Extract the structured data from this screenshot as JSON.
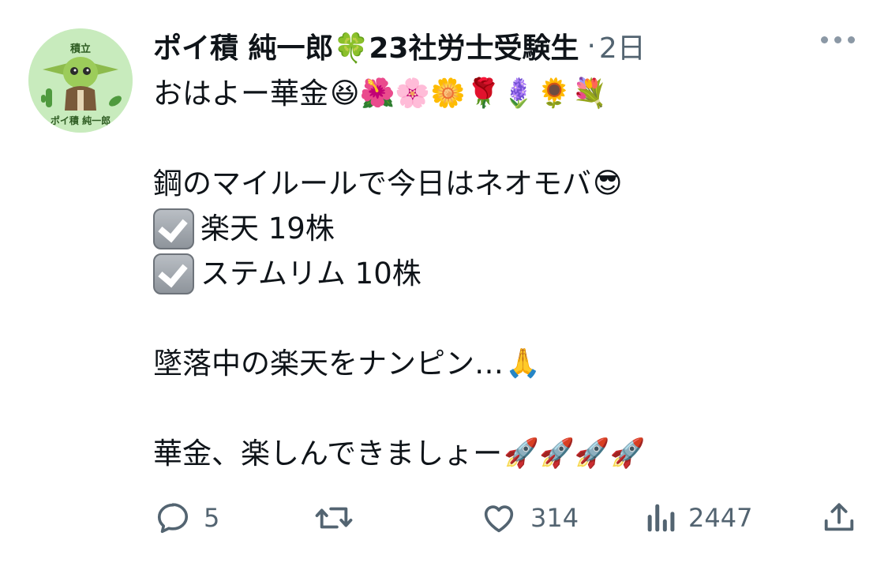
{
  "avatar": {
    "top_text": "積立",
    "bottom_text": "ポイ積 純一郎"
  },
  "header": {
    "display_name": "ポイ積 純一郎🍀23社労士受験生",
    "separator": "·",
    "time": "2日"
  },
  "post": {
    "line1_text": "おはよー華金",
    "line1_emoji": "😆🌺🌸🌼🌹🪻🌻💐",
    "line2_text": "鋼のマイルールで今日はネオモバ",
    "line2_emoji": "😎",
    "line3_text": "楽天 19株",
    "line4_text": "ステムリム 10株",
    "line5_text": "墜落中の楽天をナンピン…",
    "line5_emoji": "🙏",
    "line6_text": "華金、楽しんできましょー",
    "line6_emoji": "🚀🚀🚀🚀"
  },
  "actions": {
    "reply_count": "5",
    "repost_count": "",
    "like_count": "314",
    "view_count": "2447"
  },
  "icons": {
    "reply": "reply-icon",
    "repost": "repost-icon",
    "like": "heart-icon",
    "views": "views-icon",
    "share": "share-icon",
    "more": "more-icon",
    "checkbox": "checkmark-box-icon"
  },
  "colors": {
    "text": "#0f1419",
    "muted": "#536471",
    "avatar_bg": "#c8ebbd"
  }
}
